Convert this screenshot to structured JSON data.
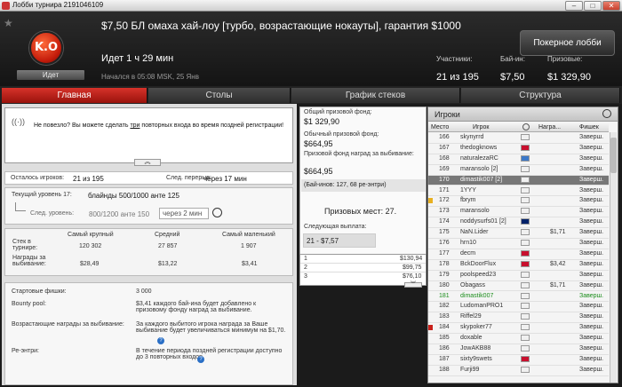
{
  "window": {
    "title": "Лобби турнира 2191046109"
  },
  "header": {
    "logo_text": "K.O",
    "status": "Идет",
    "tournament_name": "$7,50 БЛ омаха хай-лоу [турбо, возрастающие нокауты], гарантия $1000",
    "runtime": "Идет 1 ч 29 мин",
    "started": "Начался в 05:08 MSK, 25 Янв",
    "stats": [
      {
        "label": "Участники:",
        "value": "21 из 195"
      },
      {
        "label": "Бай-ин:",
        "value": "$7,50"
      },
      {
        "label": "Призовые:",
        "value": "$1 329,90"
      }
    ],
    "lobby_button": "Покерное лобби"
  },
  "tabs": [
    "Главная",
    "Столы",
    "График стеков",
    "Структура"
  ],
  "notice": {
    "pre": "Не повезло? Вы можете сделать ",
    "link": "три",
    "post": " повторных входа во время поздней регистрации!"
  },
  "info": {
    "players_left_label": "Осталось игроков:",
    "players_left": "21 из 195",
    "next_break_label": "След. перерыв:",
    "next_break": "через 17 мин",
    "current_level_label": "Текущий уровень 17:",
    "current_level": "блайнды 500/1000 анте 125",
    "next_level_label": "След. уровень:",
    "next_level": "800/1200 анте 150",
    "next_level_time": "через 2 мин"
  },
  "stacks": {
    "headers": [
      "Самый крупный",
      "Средний",
      "Самый маленький"
    ],
    "rows": [
      {
        "label": "Стек в турнире:",
        "values": [
          "120 302",
          "27 857",
          "1 907"
        ]
      },
      {
        "label": "Награды за выбивание:",
        "values": [
          "$28,49",
          "$13,22",
          "$3,41"
        ]
      }
    ]
  },
  "details": [
    {
      "label": "Стартовые фишки:",
      "value": "3 000"
    },
    {
      "label": "Bounty pool:",
      "value": "$3,41 каждого бай-ина будет добавлено к призовому фонду наград за выбивание."
    },
    {
      "label": "Возрастающие награды за выбивание:",
      "value": "За каждого выбитого игрока награда за Ваше выбивание будет увеличиваться минимум на $1,70."
    },
    {
      "label": "Ре-энтри:",
      "value": "В течение периода поздней регистрации доступно до 3 повторных входов."
    }
  ],
  "prize": {
    "total_label": "Общий призовой фонд:",
    "total": "$1 329,90",
    "regular_label": "Обычный призовой фонд:",
    "regular": "$664,95",
    "bounty_label": "Призовой фонд наград за выбивание:",
    "bounty": "$664,95",
    "buyins": "(Бай-инов: 127, 68 ре-энтри)",
    "places": "Призовых мест: 27.",
    "next_payout_label": "Следующая выплата:",
    "next_payout": "21 - $7,57",
    "payouts": [
      {
        "place": "1",
        "amount": "$130,94"
      },
      {
        "place": "2",
        "amount": "$99,75"
      },
      {
        "place": "3",
        "amount": "$76,10"
      }
    ]
  },
  "players": {
    "title": "Игроки",
    "columns": [
      "Место",
      "Игрок",
      "",
      "Награ...",
      "Фишек"
    ],
    "rows": [
      {
        "place": "166",
        "name": "skynyrrd",
        "flag": "#f0f0f0",
        "bounty": "",
        "chips": "Заверш."
      },
      {
        "place": "167",
        "name": "thedogknows",
        "flag": "#c8102e",
        "bounty": "",
        "chips": "Заверш."
      },
      {
        "place": "168",
        "name": "naturalezaRC",
        "flag": "#3c78c8",
        "bounty": "",
        "chips": "Заверш."
      },
      {
        "place": "169",
        "name": "maransolo [2]",
        "flag": "#f0f0f0",
        "bounty": "",
        "chips": "Заверш."
      },
      {
        "place": "170",
        "name": "dimastik007 [2]",
        "flag": "#f0f0f0",
        "bounty": "",
        "chips": "Заверш."
      },
      {
        "place": "171",
        "name": "1YYY",
        "flag": "#f0f0f0",
        "bounty": "",
        "chips": "Заверш."
      },
      {
        "place": "172",
        "name": "fbrym",
        "flag": "#f0f0f0",
        "bounty": "",
        "chips": "Заверш."
      },
      {
        "place": "173",
        "name": "maransolo",
        "flag": "#f0f0f0",
        "bounty": "",
        "chips": "Заверш."
      },
      {
        "place": "174",
        "name": "noddysurfs01 [2]",
        "flag": "#012169",
        "bounty": "",
        "chips": "Заверш."
      },
      {
        "place": "175",
        "name": "NaN.Lider",
        "flag": "#f0f0f0",
        "bounty": "$1,71",
        "chips": "Заверш."
      },
      {
        "place": "176",
        "name": "hrn10",
        "flag": "#f0f0f0",
        "bounty": "",
        "chips": "Заверш."
      },
      {
        "place": "177",
        "name": "decm",
        "flag": "#c8102e",
        "bounty": "",
        "chips": "Заверш."
      },
      {
        "place": "178",
        "name": "BckDoorFlux",
        "flag": "#c8102e",
        "bounty": "$3,42",
        "chips": "Заверш."
      },
      {
        "place": "179",
        "name": "poolspeed23",
        "flag": "#f0f0f0",
        "bounty": "",
        "chips": "Заверш."
      },
      {
        "place": "180",
        "name": "Obagass",
        "flag": "#f0f0f0",
        "bounty": "$1,71",
        "chips": "Заверш."
      },
      {
        "place": "181",
        "name": "dimastik007",
        "flag": "#f0f0f0",
        "bounty": "",
        "chips": "Заверш."
      },
      {
        "place": "182",
        "name": "LudomanPRO1",
        "flag": "#f0f0f0",
        "bounty": "",
        "chips": "Заверш."
      },
      {
        "place": "183",
        "name": "Riffel29",
        "flag": "#f0f0f0",
        "bounty": "",
        "chips": "Заверш."
      },
      {
        "place": "184",
        "name": "skypoker77",
        "flag": "#f0f0f0",
        "bounty": "",
        "chips": "Заверш."
      },
      {
        "place": "185",
        "name": "doxable",
        "flag": "#f0f0f0",
        "bounty": "",
        "chips": "Заверш."
      },
      {
        "place": "186",
        "name": "JowAKB88",
        "flag": "#f0f0f0",
        "bounty": "",
        "chips": "Заверш."
      },
      {
        "place": "187",
        "name": "sixty9swets",
        "flag": "#c8102e",
        "bounty": "",
        "chips": "Заверш."
      },
      {
        "place": "188",
        "name": "Furji99",
        "flag": "#f0f0f0",
        "bounty": "",
        "chips": "Заверш."
      }
    ]
  },
  "colors": {
    "accent": "#c41c0b",
    "selected_row": "#777777",
    "highlight_name": "#1a8c1a"
  }
}
